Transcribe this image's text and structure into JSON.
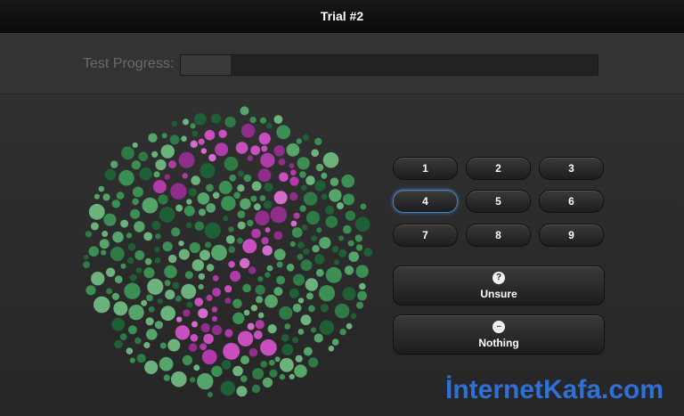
{
  "header": {
    "title": "Trial #2"
  },
  "progress": {
    "label": "Test Progress:",
    "fraction": 0.12
  },
  "plate": {
    "description_colors": {
      "background_dots": [
        "#2e7a45",
        "#3c8f53",
        "#55a46a",
        "#1f5f35",
        "#6bb27d"
      ],
      "figure_dots": [
        "#b03aa8",
        "#c94ec0",
        "#d36ccb",
        "#8e2d8a"
      ]
    },
    "background": "#2a2a2a"
  },
  "buttons": {
    "digits": [
      {
        "label": "1",
        "selected": false
      },
      {
        "label": "2",
        "selected": false
      },
      {
        "label": "3",
        "selected": false
      },
      {
        "label": "4",
        "selected": true
      },
      {
        "label": "5",
        "selected": false
      },
      {
        "label": "6",
        "selected": false
      },
      {
        "label": "7",
        "selected": false
      },
      {
        "label": "8",
        "selected": false
      },
      {
        "label": "9",
        "selected": false
      }
    ],
    "unsure": {
      "label": "Unsure",
      "icon": "question-icon",
      "glyph": "?"
    },
    "nothing": {
      "label": "Nothing",
      "icon": "ellipsis-icon",
      "glyph": "···"
    }
  },
  "watermark": {
    "text": "İnternetKafa.com",
    "color": "#2f6fd6"
  }
}
